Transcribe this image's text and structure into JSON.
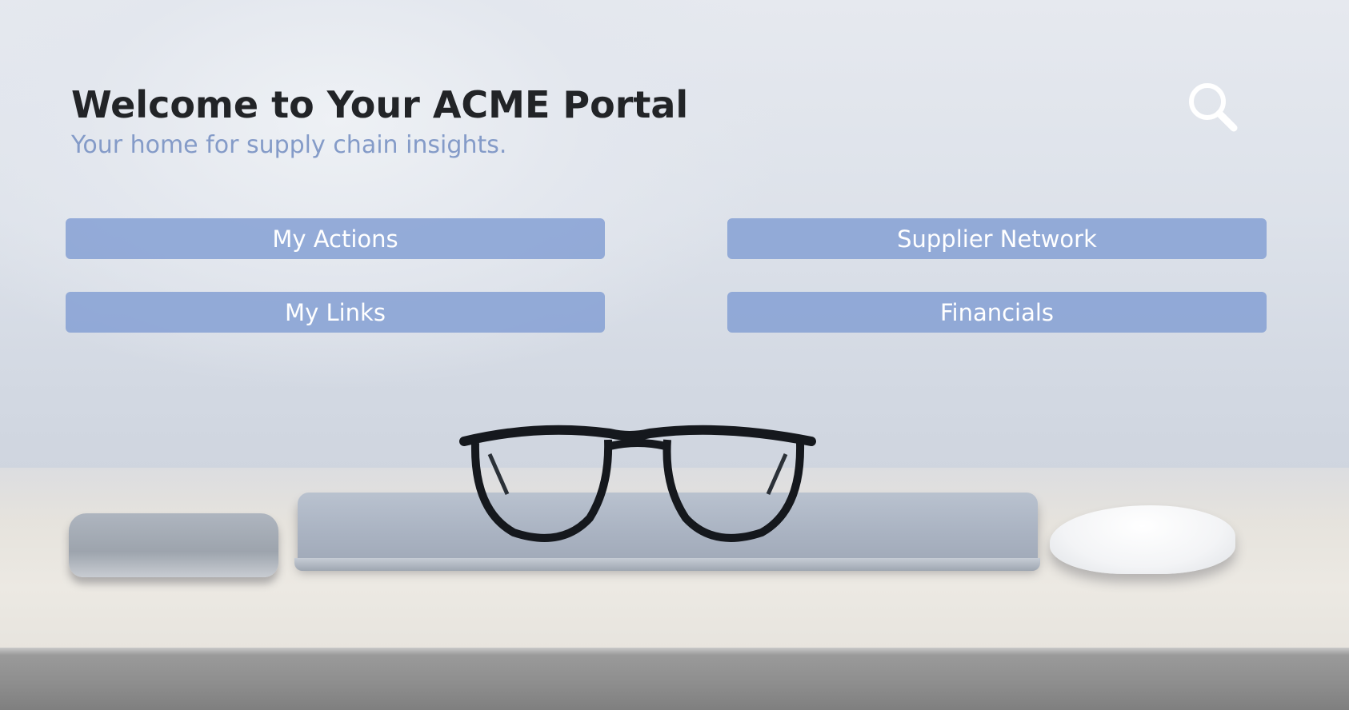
{
  "header": {
    "title": "Welcome to Your ACME Portal",
    "subtitle": "Your home for supply chain insights."
  },
  "search": {
    "icon": "search-icon",
    "color": "#ffffff"
  },
  "nav_buttons": [
    {
      "label": "My Actions"
    },
    {
      "label": "Supplier Network"
    },
    {
      "label": "My Links"
    },
    {
      "label": "Financials"
    }
  ],
  "colors": {
    "button_fill": "#85a0d4",
    "subtitle": "#849bc8",
    "title": "#222427"
  }
}
